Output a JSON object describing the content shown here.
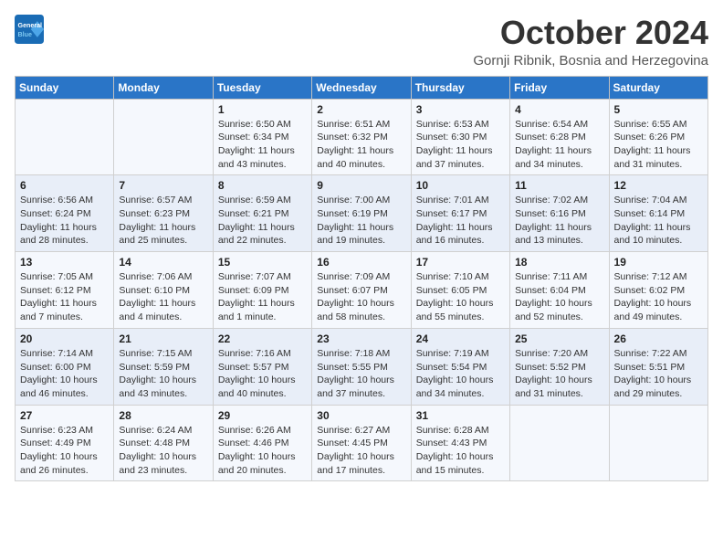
{
  "header": {
    "logo_line1": "General",
    "logo_line2": "Blue",
    "month_title": "October 2024",
    "subtitle": "Gornji Ribnik, Bosnia and Herzegovina"
  },
  "weekdays": [
    "Sunday",
    "Monday",
    "Tuesday",
    "Wednesday",
    "Thursday",
    "Friday",
    "Saturday"
  ],
  "weeks": [
    [
      {
        "day": "",
        "info": ""
      },
      {
        "day": "",
        "info": ""
      },
      {
        "day": "1",
        "info": "Sunrise: 6:50 AM\nSunset: 6:34 PM\nDaylight: 11 hours and 43 minutes."
      },
      {
        "day": "2",
        "info": "Sunrise: 6:51 AM\nSunset: 6:32 PM\nDaylight: 11 hours and 40 minutes."
      },
      {
        "day": "3",
        "info": "Sunrise: 6:53 AM\nSunset: 6:30 PM\nDaylight: 11 hours and 37 minutes."
      },
      {
        "day": "4",
        "info": "Sunrise: 6:54 AM\nSunset: 6:28 PM\nDaylight: 11 hours and 34 minutes."
      },
      {
        "day": "5",
        "info": "Sunrise: 6:55 AM\nSunset: 6:26 PM\nDaylight: 11 hours and 31 minutes."
      }
    ],
    [
      {
        "day": "6",
        "info": "Sunrise: 6:56 AM\nSunset: 6:24 PM\nDaylight: 11 hours and 28 minutes."
      },
      {
        "day": "7",
        "info": "Sunrise: 6:57 AM\nSunset: 6:23 PM\nDaylight: 11 hours and 25 minutes."
      },
      {
        "day": "8",
        "info": "Sunrise: 6:59 AM\nSunset: 6:21 PM\nDaylight: 11 hours and 22 minutes."
      },
      {
        "day": "9",
        "info": "Sunrise: 7:00 AM\nSunset: 6:19 PM\nDaylight: 11 hours and 19 minutes."
      },
      {
        "day": "10",
        "info": "Sunrise: 7:01 AM\nSunset: 6:17 PM\nDaylight: 11 hours and 16 minutes."
      },
      {
        "day": "11",
        "info": "Sunrise: 7:02 AM\nSunset: 6:16 PM\nDaylight: 11 hours and 13 minutes."
      },
      {
        "day": "12",
        "info": "Sunrise: 7:04 AM\nSunset: 6:14 PM\nDaylight: 11 hours and 10 minutes."
      }
    ],
    [
      {
        "day": "13",
        "info": "Sunrise: 7:05 AM\nSunset: 6:12 PM\nDaylight: 11 hours and 7 minutes."
      },
      {
        "day": "14",
        "info": "Sunrise: 7:06 AM\nSunset: 6:10 PM\nDaylight: 11 hours and 4 minutes."
      },
      {
        "day": "15",
        "info": "Sunrise: 7:07 AM\nSunset: 6:09 PM\nDaylight: 11 hours and 1 minute."
      },
      {
        "day": "16",
        "info": "Sunrise: 7:09 AM\nSunset: 6:07 PM\nDaylight: 10 hours and 58 minutes."
      },
      {
        "day": "17",
        "info": "Sunrise: 7:10 AM\nSunset: 6:05 PM\nDaylight: 10 hours and 55 minutes."
      },
      {
        "day": "18",
        "info": "Sunrise: 7:11 AM\nSunset: 6:04 PM\nDaylight: 10 hours and 52 minutes."
      },
      {
        "day": "19",
        "info": "Sunrise: 7:12 AM\nSunset: 6:02 PM\nDaylight: 10 hours and 49 minutes."
      }
    ],
    [
      {
        "day": "20",
        "info": "Sunrise: 7:14 AM\nSunset: 6:00 PM\nDaylight: 10 hours and 46 minutes."
      },
      {
        "day": "21",
        "info": "Sunrise: 7:15 AM\nSunset: 5:59 PM\nDaylight: 10 hours and 43 minutes."
      },
      {
        "day": "22",
        "info": "Sunrise: 7:16 AM\nSunset: 5:57 PM\nDaylight: 10 hours and 40 minutes."
      },
      {
        "day": "23",
        "info": "Sunrise: 7:18 AM\nSunset: 5:55 PM\nDaylight: 10 hours and 37 minutes."
      },
      {
        "day": "24",
        "info": "Sunrise: 7:19 AM\nSunset: 5:54 PM\nDaylight: 10 hours and 34 minutes."
      },
      {
        "day": "25",
        "info": "Sunrise: 7:20 AM\nSunset: 5:52 PM\nDaylight: 10 hours and 31 minutes."
      },
      {
        "day": "26",
        "info": "Sunrise: 7:22 AM\nSunset: 5:51 PM\nDaylight: 10 hours and 29 minutes."
      }
    ],
    [
      {
        "day": "27",
        "info": "Sunrise: 6:23 AM\nSunset: 4:49 PM\nDaylight: 10 hours and 26 minutes."
      },
      {
        "day": "28",
        "info": "Sunrise: 6:24 AM\nSunset: 4:48 PM\nDaylight: 10 hours and 23 minutes."
      },
      {
        "day": "29",
        "info": "Sunrise: 6:26 AM\nSunset: 4:46 PM\nDaylight: 10 hours and 20 minutes."
      },
      {
        "day": "30",
        "info": "Sunrise: 6:27 AM\nSunset: 4:45 PM\nDaylight: 10 hours and 17 minutes."
      },
      {
        "day": "31",
        "info": "Sunrise: 6:28 AM\nSunset: 4:43 PM\nDaylight: 10 hours and 15 minutes."
      },
      {
        "day": "",
        "info": ""
      },
      {
        "day": "",
        "info": ""
      }
    ]
  ]
}
